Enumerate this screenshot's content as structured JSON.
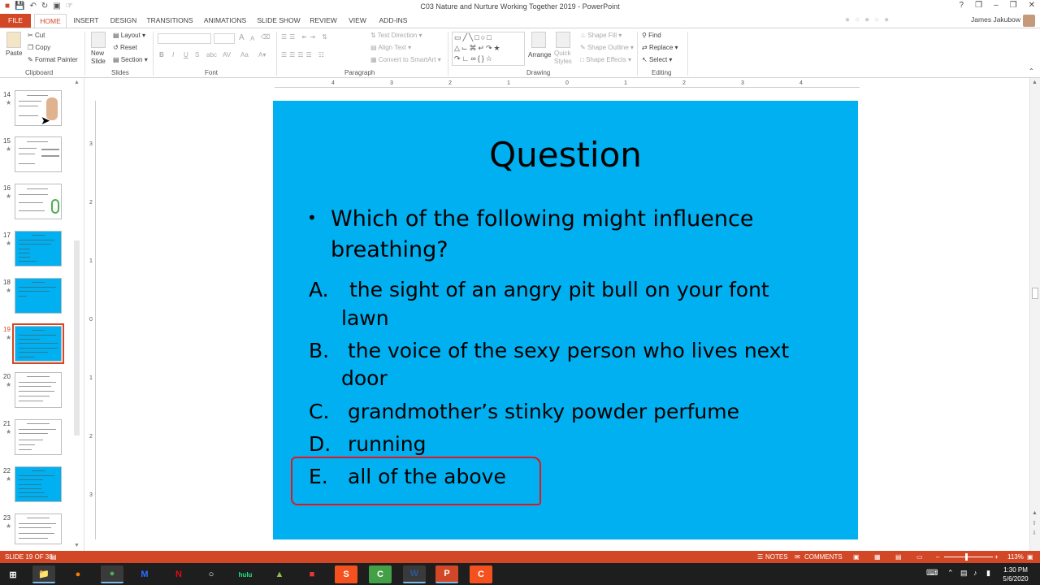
{
  "window": {
    "title": "C03 Nature and Nurture Working Together 2019 - PowerPoint",
    "user": "James Jakubow",
    "controls": [
      "?",
      "❒",
      "–",
      "❐",
      "✕"
    ]
  },
  "tabs": [
    "FILE",
    "HOME",
    "INSERT",
    "DESIGN",
    "TRANSITIONS",
    "ANIMATIONS",
    "SLIDE SHOW",
    "REVIEW",
    "VIEW",
    "ADD-INS"
  ],
  "ribbon": {
    "clipboard": {
      "label": "Clipboard",
      "paste": "Paste",
      "cut": "Cut",
      "copy": "Copy",
      "format_painter": "Format Painter"
    },
    "slides": {
      "label": "Slides",
      "new_slide": "New Slide",
      "layout": "Layout",
      "reset": "Reset",
      "section": "Section"
    },
    "font": {
      "label": "Font",
      "bold": "B",
      "italic": "I",
      "underline": "U",
      "strike": "S",
      "grow": "A",
      "shrink": "A"
    },
    "paragraph": {
      "label": "Paragraph",
      "text_direction": "Text Direction",
      "align_text": "Align Text",
      "convert_smartart": "Convert to SmartArt"
    },
    "drawing": {
      "label": "Drawing",
      "arrange": "Arrange",
      "quick_styles": "Quick Styles",
      "shape_fill": "Shape Fill",
      "shape_outline": "Shape Outline",
      "shape_effects": "Shape Effects"
    },
    "editing": {
      "label": "Editing",
      "find": "Find",
      "replace": "Replace",
      "select": "Select"
    }
  },
  "thumbnails": [
    {
      "num": "14",
      "star": "★",
      "blue": false
    },
    {
      "num": "15",
      "star": "★",
      "blue": false
    },
    {
      "num": "16",
      "star": "★",
      "blue": false
    },
    {
      "num": "17",
      "star": "★",
      "blue": true
    },
    {
      "num": "18",
      "star": "★",
      "blue": true
    },
    {
      "num": "19",
      "star": "★",
      "blue": true
    },
    {
      "num": "20",
      "star": "★",
      "blue": false
    },
    {
      "num": "21",
      "star": "★",
      "blue": false
    },
    {
      "num": "22",
      "star": "★",
      "blue": true
    },
    {
      "num": "23",
      "star": "★",
      "blue": false
    }
  ],
  "ruler": {
    "h": [
      "4",
      "3",
      "2",
      "1",
      "0",
      "1",
      "2",
      "3",
      "4"
    ],
    "v": [
      "3",
      "2",
      "1",
      "0",
      "1",
      "2",
      "3"
    ]
  },
  "slide": {
    "title": "Question",
    "bullet_marker": "•",
    "bullet_line1": "Which of the following might influence",
    "bullet_line2": "breathing?",
    "a_letter": "A.",
    "a_line1": "the sight of an angry pit bull on your font",
    "a_line2": "lawn",
    "b_letter": "B.",
    "b_line1": "the voice of the sexy person who lives next",
    "b_line2": "door",
    "c_letter": "C.",
    "c_line1": "grandmother’s stinky powder perfume",
    "d_letter": "D.",
    "d_line1": "running",
    "e_letter": "E.",
    "e_line1": "all of the above"
  },
  "status": {
    "slide_of": "SLIDE 19 OF 38",
    "notes": "NOTES",
    "comments": "COMMENTS",
    "zoom": "113%"
  },
  "clock": {
    "time": "1:30 PM",
    "date": "5/6/2020"
  },
  "taskbar": [
    "⊞",
    "📁",
    "●",
    "●",
    "M",
    "N",
    "○",
    "hulu",
    "▲",
    "■",
    "S",
    "C",
    "W",
    "P",
    "C"
  ]
}
